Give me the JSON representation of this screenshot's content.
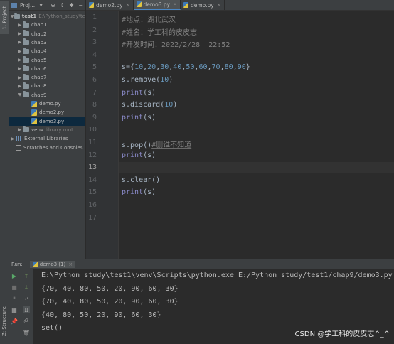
{
  "project_panel": {
    "title": "Proj...",
    "side_tabs": {
      "project": "1: Project",
      "structure": "Z: Structure"
    },
    "tree": [
      {
        "label": "test1",
        "suffix": "E:\\Python_study\\te",
        "type": "folder",
        "expanded": true,
        "depth": 0
      },
      {
        "label": "chap1",
        "type": "folder",
        "expanded": false,
        "depth": 1
      },
      {
        "label": "chap2",
        "type": "folder",
        "expanded": false,
        "depth": 1
      },
      {
        "label": "chap3",
        "type": "folder",
        "expanded": false,
        "depth": 1
      },
      {
        "label": "chap4",
        "type": "folder",
        "expanded": false,
        "depth": 1
      },
      {
        "label": "chap5",
        "type": "folder",
        "expanded": false,
        "depth": 1
      },
      {
        "label": "chap6",
        "type": "folder",
        "expanded": false,
        "depth": 1
      },
      {
        "label": "chap7",
        "type": "folder",
        "expanded": false,
        "depth": 1
      },
      {
        "label": "chap8",
        "type": "folder",
        "expanded": false,
        "depth": 1
      },
      {
        "label": "chap9",
        "type": "folder",
        "expanded": true,
        "depth": 1
      },
      {
        "label": "demo.py",
        "type": "py",
        "depth": 2
      },
      {
        "label": "demo2.py",
        "type": "py",
        "depth": 2
      },
      {
        "label": "demo3.py",
        "type": "py",
        "depth": 2,
        "selected": true
      },
      {
        "label": "venv",
        "suffix": "library root",
        "type": "folder",
        "expanded": false,
        "depth": 1
      },
      {
        "label": "External Libraries",
        "type": "extlib",
        "expanded": false,
        "depth": 0
      },
      {
        "label": "Scratches and Consoles",
        "type": "scratch",
        "depth": 0
      }
    ]
  },
  "editor": {
    "tabs": [
      {
        "label": "demo2.py",
        "active": false
      },
      {
        "label": "demo3.py",
        "active": true
      },
      {
        "label": "demo.py",
        "active": false
      }
    ],
    "current_line": 13,
    "lines": [
      {
        "n": "1",
        "text": "#地点：湖北武汉",
        "kind": "comment"
      },
      {
        "n": "2",
        "text": "#姓名：学工科的皮皮志",
        "kind": "comment"
      },
      {
        "n": "3",
        "text": "#开发时间：2022/2/28  22:52",
        "kind": "comment"
      },
      {
        "n": "4",
        "text": "",
        "kind": "plain"
      },
      {
        "n": "5",
        "text": "s={10,20,30,40,50,60,70,80,90}",
        "kind": "set"
      },
      {
        "n": "6",
        "text": "s.remove(10)",
        "kind": "call"
      },
      {
        "n": "7",
        "text": "print(s)",
        "kind": "print"
      },
      {
        "n": "8",
        "text": "s.discard(10)",
        "kind": "call"
      },
      {
        "n": "9",
        "text": "print(s)",
        "kind": "print"
      },
      {
        "n": "10",
        "text": "",
        "kind": "plain"
      },
      {
        "n": "11",
        "text": "s.pop()#删谁不知道",
        "kind": "popcomment"
      },
      {
        "n": "12",
        "text": "print(s)",
        "kind": "print"
      },
      {
        "n": "13",
        "text": "",
        "kind": "plain"
      },
      {
        "n": "14",
        "text": "s.clear()",
        "kind": "plain"
      },
      {
        "n": "15",
        "text": "print(s)",
        "kind": "print"
      },
      {
        "n": "16",
        "text": "",
        "kind": "plain"
      },
      {
        "n": "17",
        "text": "",
        "kind": "plain"
      }
    ]
  },
  "run_panel": {
    "label": "Run:",
    "config": "demo3 (1)",
    "close": "×",
    "output": [
      "E:\\Python_study\\test1\\venv\\Scripts\\python.exe E:/Python_study/test1/chap9/demo3.py",
      "{70, 40, 80, 50, 20, 90, 60, 30}",
      "{70, 40, 80, 50, 20, 90, 60, 30}",
      "{40, 80, 50, 20, 90, 60, 30}",
      "set()"
    ]
  },
  "watermark": "CSDN @学工科的皮皮志^_^",
  "colors": {
    "selection": "#0d293e",
    "accent": "#4a88c7",
    "comment": "#808080",
    "number": "#6897bb",
    "builtin": "#8888c6"
  }
}
